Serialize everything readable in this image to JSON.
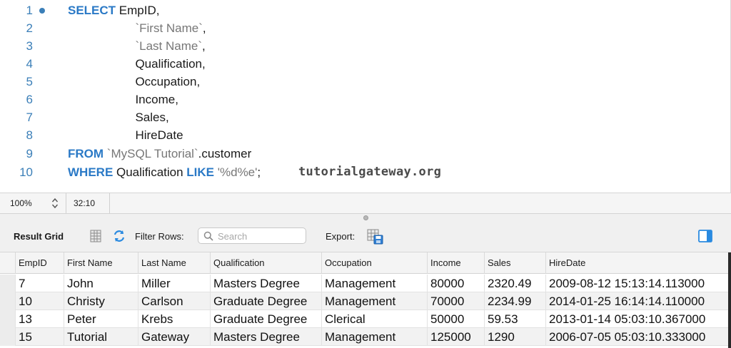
{
  "editor": {
    "lines": [
      {
        "num": "1",
        "tokens": [
          {
            "t": "SELECT",
            "c": "kw"
          },
          {
            "t": " EmpID,",
            "c": ""
          }
        ]
      },
      {
        "num": "2",
        "tokens": [
          {
            "t": "                    ",
            "c": ""
          },
          {
            "t": "`First Name`",
            "c": "str"
          },
          {
            "t": ",",
            "c": ""
          }
        ]
      },
      {
        "num": "3",
        "tokens": [
          {
            "t": "                    ",
            "c": ""
          },
          {
            "t": "`Last Name`",
            "c": "str"
          },
          {
            "t": ",",
            "c": ""
          }
        ]
      },
      {
        "num": "4",
        "tokens": [
          {
            "t": "                    Qualification,",
            "c": ""
          }
        ]
      },
      {
        "num": "5",
        "tokens": [
          {
            "t": "                    Occupation,",
            "c": ""
          }
        ]
      },
      {
        "num": "6",
        "tokens": [
          {
            "t": "                    Income,",
            "c": ""
          }
        ]
      },
      {
        "num": "7",
        "tokens": [
          {
            "t": "                    Sales,",
            "c": ""
          }
        ]
      },
      {
        "num": "8",
        "tokens": [
          {
            "t": "                    HireDate",
            "c": ""
          }
        ]
      },
      {
        "num": "9",
        "tokens": [
          {
            "t": "FROM",
            "c": "kw"
          },
          {
            "t": " ",
            "c": ""
          },
          {
            "t": "`MySQL Tutorial`",
            "c": "str"
          },
          {
            "t": ".customer",
            "c": ""
          }
        ]
      },
      {
        "num": "10",
        "tokens": [
          {
            "t": "WHERE",
            "c": "kw"
          },
          {
            "t": " Qualification ",
            "c": ""
          },
          {
            "t": "LIKE",
            "c": "kw"
          },
          {
            "t": " ",
            "c": ""
          },
          {
            "t": "'%d%e'",
            "c": "str"
          },
          {
            "t": ";",
            "c": ""
          }
        ]
      }
    ],
    "watermark": "tutorialgateway.org"
  },
  "statusbar": {
    "zoom": "100%",
    "cursor_position": "32:10"
  },
  "toolbar": {
    "result_grid_label": "Result Grid",
    "filter_rows_label": "Filter Rows:",
    "search_placeholder": "Search",
    "export_label": "Export:"
  },
  "grid": {
    "columns": [
      "EmpID",
      "First Name",
      "Last Name",
      "Qualification",
      "Occupation",
      "Income",
      "Sales",
      "HireDate"
    ],
    "rows": [
      [
        "7",
        "John",
        "Miller",
        "Masters Degree",
        "Management",
        "80000",
        "2320.49",
        "2009-08-12 15:13:14.113000"
      ],
      [
        "10",
        "Christy",
        "Carlson",
        "Graduate Degree",
        "Management",
        "70000",
        "2234.99",
        "2014-01-25 16:14:14.110000"
      ],
      [
        "13",
        "Peter",
        "Krebs",
        "Graduate Degree",
        "Clerical",
        "50000",
        "59.53",
        "2013-01-14 05:03:10.367000"
      ],
      [
        "15",
        "Tutorial",
        "Gateway",
        "Masters Degree",
        "Management",
        "125000",
        "1290",
        "2006-07-05 05:03:10.333000"
      ]
    ]
  },
  "colors": {
    "keyword": "#2a79c6",
    "line_number": "#3b7fb8",
    "string": "#777777",
    "icon_blue": "#2a8ae0"
  },
  "icons": [
    "grid-icon",
    "refresh-icon",
    "search-icon",
    "export-icon",
    "panel-toggle-icon",
    "stepper-icon",
    "breakpoint-dot"
  ]
}
